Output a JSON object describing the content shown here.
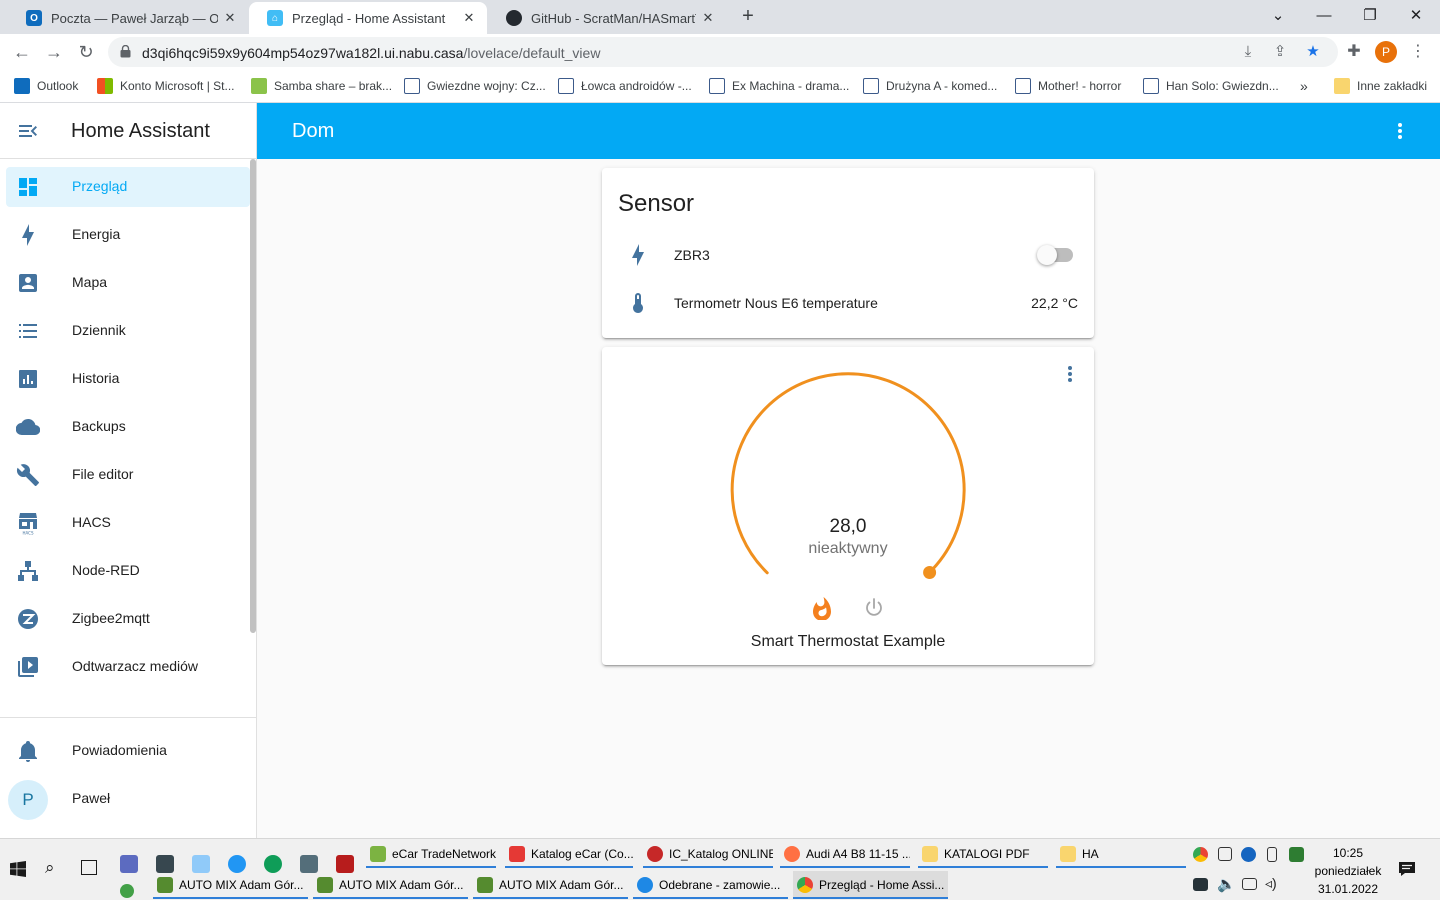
{
  "browser": {
    "tabs": [
      {
        "title": "Poczta — Paweł Jarząb — Outlook",
        "close": "✕"
      },
      {
        "title": "Przegląd - Home Assistant",
        "close": "✕"
      },
      {
        "title": "GitHub - ScratMan/HASmartThermostat",
        "close": "✕"
      }
    ],
    "new_tab": "+",
    "url_host": "d3qi6hqc9i59x9y604mp54oz97wa182l.ui.nabu.casa",
    "url_path": "/lovelace/default_view",
    "profile_initial": "P",
    "bookmarks": [
      "Outlook",
      "Konto Microsoft | St...",
      "Samba share – brak...",
      "Gwiezdne wojny: Cz...",
      "Łowca androidów -...",
      "Ex Machina - drama...",
      "Drużyna A - komed...",
      "Mother! - horror",
      "Han Solo: Gwiezdn...",
      "Inne zakładki"
    ],
    "bookmarks_more": "»"
  },
  "sidebar": {
    "title": "Home Assistant",
    "items": [
      {
        "label": "Przegląd",
        "icon": "dashboard-icon"
      },
      {
        "label": "Energia",
        "icon": "lightning-icon"
      },
      {
        "label": "Mapa",
        "icon": "account-box-icon"
      },
      {
        "label": "Dziennik",
        "icon": "list-icon"
      },
      {
        "label": "Historia",
        "icon": "chart-icon"
      },
      {
        "label": "Backups",
        "icon": "cloud-icon"
      },
      {
        "label": "File editor",
        "icon": "wrench-icon"
      },
      {
        "label": "HACS",
        "icon": "hacs-icon"
      },
      {
        "label": "Node-RED",
        "icon": "sitemap-icon"
      },
      {
        "label": "Zigbee2mqtt",
        "icon": "zigbee-icon"
      },
      {
        "label": "Odtwarzacz mediów",
        "icon": "play-box-icon"
      }
    ],
    "notifications": "Powiadomienia",
    "user_name": "Paweł",
    "user_initial": "P"
  },
  "header": {
    "title": "Dom"
  },
  "sensor_card": {
    "title": "Sensor",
    "entities": [
      {
        "name": "ZBR3",
        "state": "off",
        "icon": "lightning-icon"
      },
      {
        "name": "Termometr Nous E6 temperature",
        "state": "22,2 °C",
        "icon": "thermometer-icon"
      }
    ]
  },
  "thermostat": {
    "target": "28,0",
    "status": "nieaktywny",
    "name": "Smart Thermostat Example",
    "accent": "#f0901e"
  },
  "taskbar": {
    "row1": [
      "eCar TradeNetwork",
      "Katalog eCar (Co...",
      "IC_Katalog ONLINE",
      "Audi A4 B8 11-15 ...",
      "KATALOGI PDF",
      "HA"
    ],
    "row2": [
      "AUTO MIX Adam Gór...",
      "AUTO MIX Adam Gór...",
      "AUTO MIX Adam Gór...",
      "Odebrane - zamowie...",
      "Przegląd - Home Assi..."
    ],
    "clock_time": "10:25",
    "clock_day": "poniedziałek",
    "clock_date": "31.01.2022"
  },
  "colors": {
    "ha_primary": "#03a9f4",
    "sidebar_icon": "#44739e",
    "thermostat_orange": "#f0901e"
  }
}
